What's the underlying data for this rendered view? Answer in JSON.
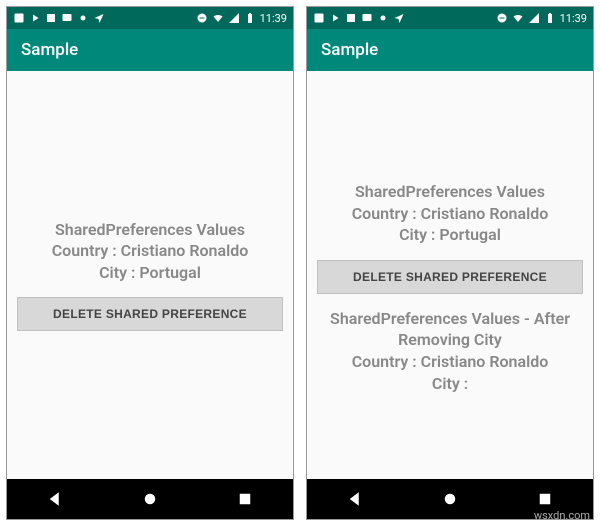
{
  "status": {
    "time": "11:39"
  },
  "app": {
    "title": "Sample"
  },
  "screen1": {
    "text_title": "SharedPreferences Values",
    "text_country": "Country : Cristiano Ronaldo",
    "text_city": "City : Portugal",
    "button_label": "DELETE SHARED PREFERENCE"
  },
  "screen2": {
    "text_title": "SharedPreferences Values",
    "text_country": "Country : Cristiano Ronaldo",
    "text_city": "City : Portugal",
    "button_label": "DELETE SHARED PREFERENCE",
    "after_title": "SharedPreferences Values - After Removing City",
    "after_country": "Country : Cristiano Ronaldo",
    "after_city": "City :"
  },
  "watermark": "wsxdn.com"
}
